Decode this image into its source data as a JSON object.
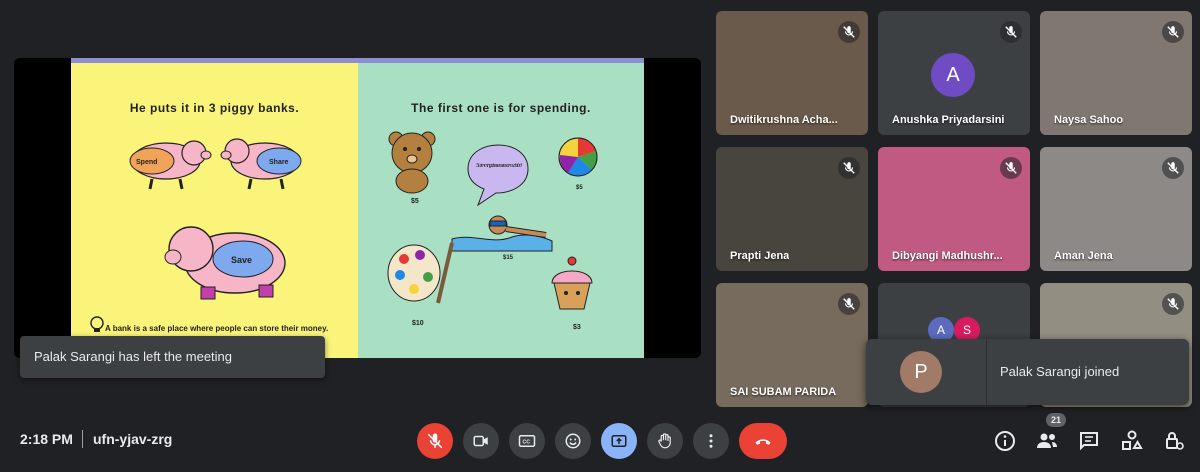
{
  "slide": {
    "left_heading": "He puts it in 3 piggy banks.",
    "right_heading": "The first one is for spending.",
    "pig_labels": [
      "Spend",
      "Share",
      "Save"
    ],
    "footnote": "A bank is a safe place where people can store their money.",
    "bubble_text": "Swimming classes are so much fun!",
    "prices": [
      "$5",
      "$5",
      "$15",
      "$10",
      "$3"
    ]
  },
  "participants": [
    {
      "name": "Dwitikrushna Acha...",
      "muted": true,
      "bg": "#6a5a4c"
    },
    {
      "name": "Anushka Priyadarsini",
      "muted": true,
      "avatar": "A",
      "avatar_color": "#6f4cc4",
      "bg": "#3c4043"
    },
    {
      "name": "Naysa Sahoo",
      "muted": true,
      "bg": "#7f7770"
    },
    {
      "name": "Prapti Jena",
      "muted": true,
      "bg": "#48453e"
    },
    {
      "name": "Dibyangi Madhushr...",
      "muted": true,
      "bg": "#c05a83"
    },
    {
      "name": "Aman Jena",
      "muted": true,
      "bg": "#8c8986"
    },
    {
      "name": "SAI SUBAM PARIDA",
      "muted": true,
      "bg": "#766b5d"
    },
    {
      "name": "",
      "muted": false,
      "avatars": [
        "A",
        "S"
      ],
      "bg": "#3c4043"
    },
    {
      "name": "",
      "muted": true,
      "bg": "#938e82"
    }
  ],
  "toasts": {
    "left": "Palak Sarangi has left the meeting",
    "right": "Palak Sarangi joined",
    "right_avatar": "P"
  },
  "meeting": {
    "time": "2:18 PM",
    "code": "ufn-yjav-zrg",
    "people_count": "21"
  },
  "controls": [
    "mic-off",
    "camera",
    "captions",
    "emoji",
    "present",
    "raise-hand",
    "more",
    "end-call"
  ],
  "colors": {
    "danger": "#ea4335",
    "present_active": "#8ab4f8",
    "bar_bg": "#3c4043"
  }
}
